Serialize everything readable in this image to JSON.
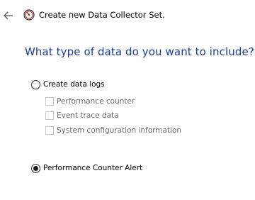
{
  "header": {
    "back_icon": "back-arrow-icon",
    "wizard_icon": "data-collector-icon",
    "title": "Create new Data Collector Set."
  },
  "main": {
    "question": "What type of data do you want to include?",
    "options": {
      "create_data_logs": {
        "label": "Create data logs",
        "selected": false
      },
      "performance_counter_alert": {
        "label": "Performance Counter Alert",
        "selected": true
      }
    },
    "data_log_types": [
      {
        "label": "Performance counter",
        "checked": false,
        "enabled": false
      },
      {
        "label": "Event trace data",
        "checked": false,
        "enabled": false
      },
      {
        "label": "System configuration information",
        "checked": false,
        "enabled": false
      }
    ]
  },
  "colors": {
    "question_text": "#1a3b9a",
    "disabled_text": "#6d6d6d",
    "disabled_border": "#c8c8c8",
    "icon_red": "#b8242a"
  }
}
